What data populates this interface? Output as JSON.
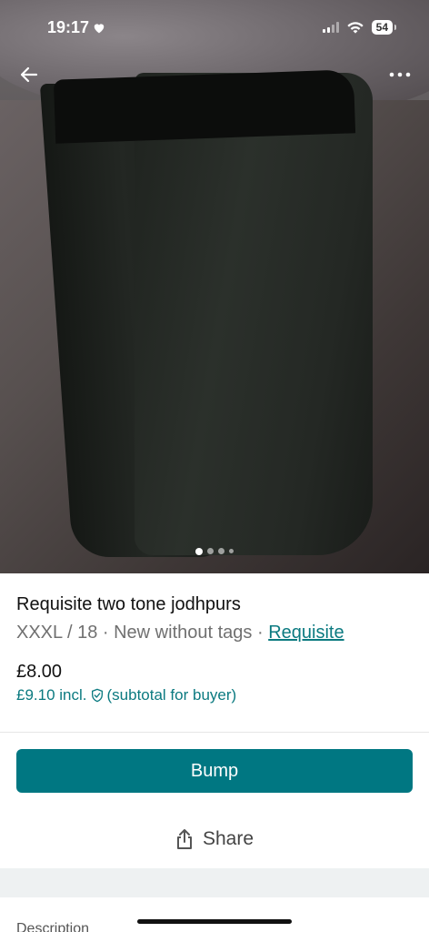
{
  "status_bar": {
    "time": "19:17",
    "battery": "54"
  },
  "icons": {
    "back": "arrow-left-icon",
    "more": "more-horizontal-icon",
    "share": "share-icon",
    "protection": "shield-check-icon"
  },
  "carousel": {
    "count": 4,
    "active_index": 0
  },
  "item": {
    "title": "Requisite two tone jodhpurs",
    "size": "XXXL / 18",
    "condition": "New without tags",
    "brand": "Requisite",
    "price": "£8.00",
    "price_incl": "£9.10 incl.",
    "price_incl_note": "(subtotal for buyer)"
  },
  "actions": {
    "bump_label": "Bump",
    "share_label": "Share"
  },
  "sections": {
    "description_label": "Description"
  },
  "colors": {
    "accent": "#007782",
    "link": "#0b7a80"
  }
}
